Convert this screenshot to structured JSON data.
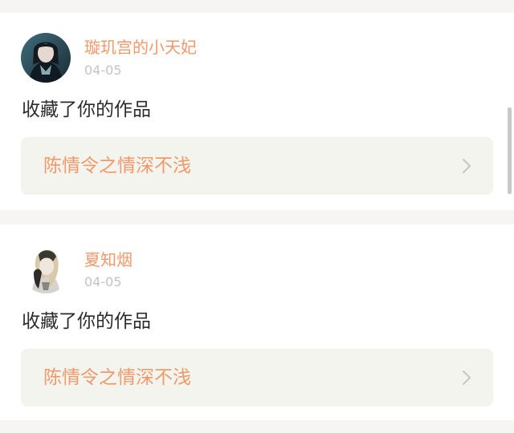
{
  "colors": {
    "accent": "#f0996a",
    "page_background": "#f6f5f3",
    "card_background": "#ffffff",
    "link_box_background": "#f4f4ee",
    "body_text": "#2b2b2b",
    "muted_text": "#c4c4c4",
    "chevron": "#c8c8c8",
    "scrollbar": "#c9c9c9"
  },
  "notifications": [
    {
      "avatar_icon": "user-avatar-icon",
      "username": "璇玑宫的小天妃",
      "date": "04-05",
      "action": "收藏了你的作品",
      "work_title": "陈情令之情深不浅",
      "chevron_icon": "chevron-right-icon"
    },
    {
      "avatar_icon": "user-avatar-icon",
      "username": "夏知烟",
      "date": "04-05",
      "action": "收藏了你的作品",
      "work_title": "陈情令之情深不浅",
      "chevron_icon": "chevron-right-icon"
    }
  ]
}
